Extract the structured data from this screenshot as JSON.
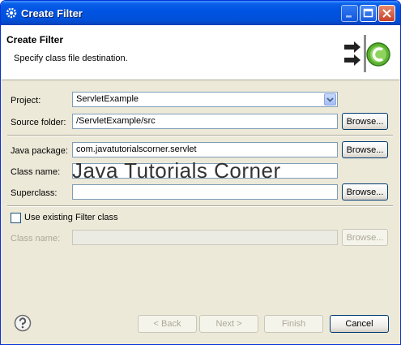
{
  "window": {
    "title": "Create Filter"
  },
  "header": {
    "title": "Create Filter",
    "description": "Specify class file destination."
  },
  "form": {
    "project_label": "Project:",
    "project_value": "ServletExample",
    "source_folder_label": "Source folder:",
    "source_folder_value": "/ServletExample/src",
    "java_package_label": "Java package:",
    "java_package_value": "com.javatutorialscorner.servlet",
    "class_name_label": "Class name:",
    "class_name_value": "",
    "superclass_label": "Superclass:",
    "superclass_value": "",
    "use_existing_label": "Use existing Filter class",
    "existing_class_name_label": "Class name:",
    "existing_class_name_value": "",
    "browse_label": "Browse..."
  },
  "watermark": "Java Tutorials Corner",
  "footer": {
    "back_label": "< Back",
    "next_label": "Next >",
    "finish_label": "Finish",
    "cancel_label": "Cancel"
  },
  "colors": {
    "titlebar": "#0054e3",
    "dialog_bg": "#ece9d8",
    "wizard_icon_green": "#5db134"
  },
  "icons": {
    "title": "gear-icon",
    "wizard": "new-class-wizard-icon",
    "help": "help-icon",
    "minimize": "minimize-icon",
    "maximize": "maximize-icon",
    "close": "close-icon"
  }
}
